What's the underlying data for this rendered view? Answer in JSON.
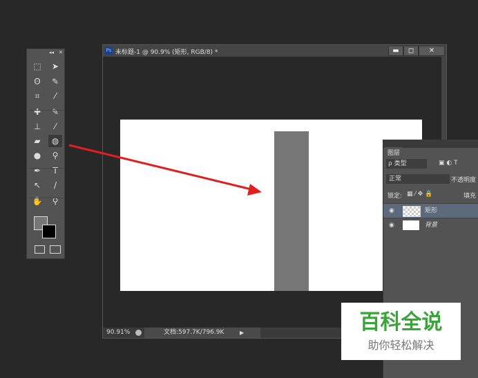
{
  "toolbar": {
    "collapse": "◂◂",
    "close": "✕",
    "tools": [
      {
        "name": "marquee",
        "g": "⬚"
      },
      {
        "name": "move",
        "g": "➤"
      },
      {
        "name": "lasso",
        "g": "ʘ"
      },
      {
        "name": "quick-select",
        "g": "✎"
      },
      {
        "name": "crop",
        "g": "⌗"
      },
      {
        "name": "eyedropper",
        "g": "⁄"
      },
      {
        "name": "healing",
        "g": "✚"
      },
      {
        "name": "brush",
        "g": "✎"
      },
      {
        "name": "stamp",
        "g": "⊥"
      },
      {
        "name": "history-brush",
        "g": "⁄"
      },
      {
        "name": "eraser",
        "g": "▰"
      },
      {
        "name": "paint-bucket",
        "g": "◍"
      },
      {
        "name": "blur",
        "g": "●"
      },
      {
        "name": "dodge",
        "g": "⚲"
      },
      {
        "name": "pen",
        "g": "✒"
      },
      {
        "name": "type",
        "g": "T"
      },
      {
        "name": "path-select",
        "g": "↖"
      },
      {
        "name": "line",
        "g": "/"
      },
      {
        "name": "hand",
        "g": "✋"
      },
      {
        "name": "zoom",
        "g": "⚲"
      }
    ]
  },
  "document": {
    "title": "未标题-1 @ 90.9% (矩形, RGB/8) *",
    "ps_badge": "Ps",
    "minimize": "▬",
    "maximize": "◻",
    "close": "✕",
    "zoom": "90.91%",
    "doc_info": "文档:597.7K/796.9K",
    "menu_arrow": "▶"
  },
  "layers": {
    "tab": "图层",
    "filter_type": "ρ 类型",
    "blend_mode": "正常",
    "opacity_label": "不透明度",
    "lock_label": "锁定:",
    "fill_label": "填充",
    "items": [
      {
        "name": "矩形"
      },
      {
        "name": "背景"
      }
    ]
  },
  "watermark": {
    "title": "百科全说",
    "subtitle": "助你轻松解决"
  },
  "colors": {
    "arrow": "#e02020",
    "shape": "#777777",
    "watermark": "#3aa33a"
  }
}
